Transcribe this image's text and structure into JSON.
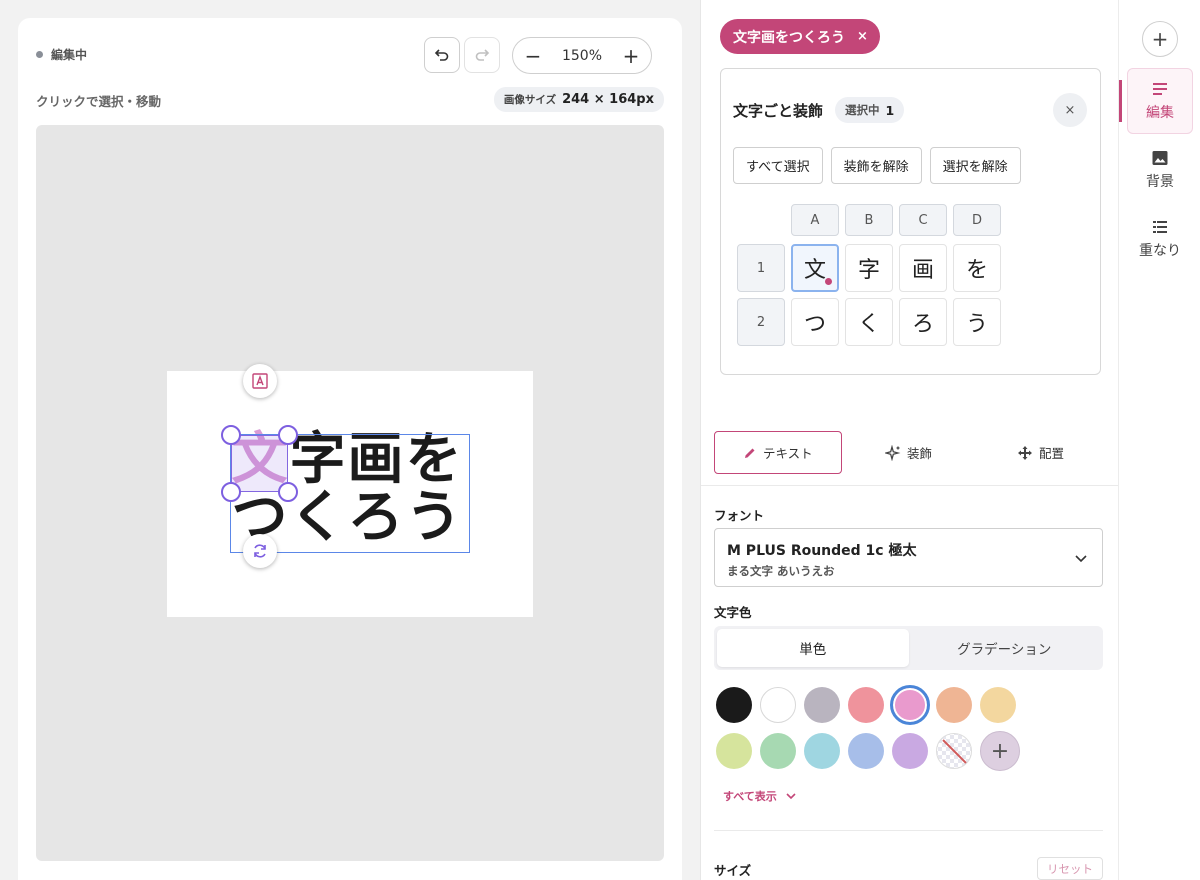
{
  "canvas": {
    "status": "編集中",
    "undo_icon": "undo-icon",
    "redo_icon": "redo-icon",
    "zoom": {
      "minus": "−",
      "value": "150%",
      "plus": "+"
    },
    "hint": "クリックで選択・移動",
    "image_size": {
      "label": "画像サイズ",
      "value": "244 × 164px"
    },
    "art_rows": [
      [
        "文",
        "字",
        "画",
        "を"
      ],
      [
        "つ",
        "く",
        "ろ",
        "う"
      ]
    ],
    "art_color": "#1b1b1b",
    "highlight_color": "#d99bd6"
  },
  "panel": {
    "chip": {
      "label": "文字画をつくろう",
      "close": "×"
    },
    "deco": {
      "title": "文字ごと装飾",
      "badge_label": "選択中",
      "badge_count": "1",
      "close": "×",
      "actions": [
        "すべて選択",
        "装飾を解除",
        "選択を解除"
      ],
      "columns": [
        "A",
        "B",
        "C",
        "D"
      ],
      "rows": [
        {
          "label": "1",
          "chars": [
            "文",
            "字",
            "画",
            "を"
          ]
        },
        {
          "label": "2",
          "chars": [
            "つ",
            "く",
            "ろ",
            "う"
          ]
        }
      ],
      "active_cell": "文"
    },
    "tabs": [
      {
        "label": "テキスト",
        "icon": "pencil-icon",
        "active": true
      },
      {
        "label": "装飾",
        "icon": "sparkle-icon",
        "active": false
      },
      {
        "label": "配置",
        "icon": "move-icon",
        "active": false
      }
    ],
    "font": {
      "label": "フォント",
      "name": "M PLUS Rounded 1c 極太",
      "sample": "まる文字 あいうえお"
    },
    "color": {
      "label": "文字色",
      "modes": [
        "単色",
        "グラデーション"
      ],
      "active_mode": "単色",
      "swatches_row1": [
        "#1a1a1a",
        "#ffffff",
        "#b9b4bf",
        "#ef939c",
        "#e99acd",
        "#efb594",
        "#f3d79f"
      ],
      "swatches_row2": [
        "#d6e49d",
        "#a7d9b2",
        "#9fd6e1",
        "#a7bee9",
        "#c9a9e2"
      ],
      "selected_swatch": "#e99acd",
      "accent": "#c34678",
      "show_all": "すべて表示"
    },
    "size": {
      "label": "サイズ",
      "reset": "リセット"
    }
  },
  "rail": {
    "add": "+",
    "items": [
      {
        "label": "編集",
        "icon": "edit-icon",
        "active": true
      },
      {
        "label": "背景",
        "icon": "image-icon",
        "active": false
      },
      {
        "label": "重なり",
        "icon": "layers-icon",
        "active": false
      }
    ]
  }
}
